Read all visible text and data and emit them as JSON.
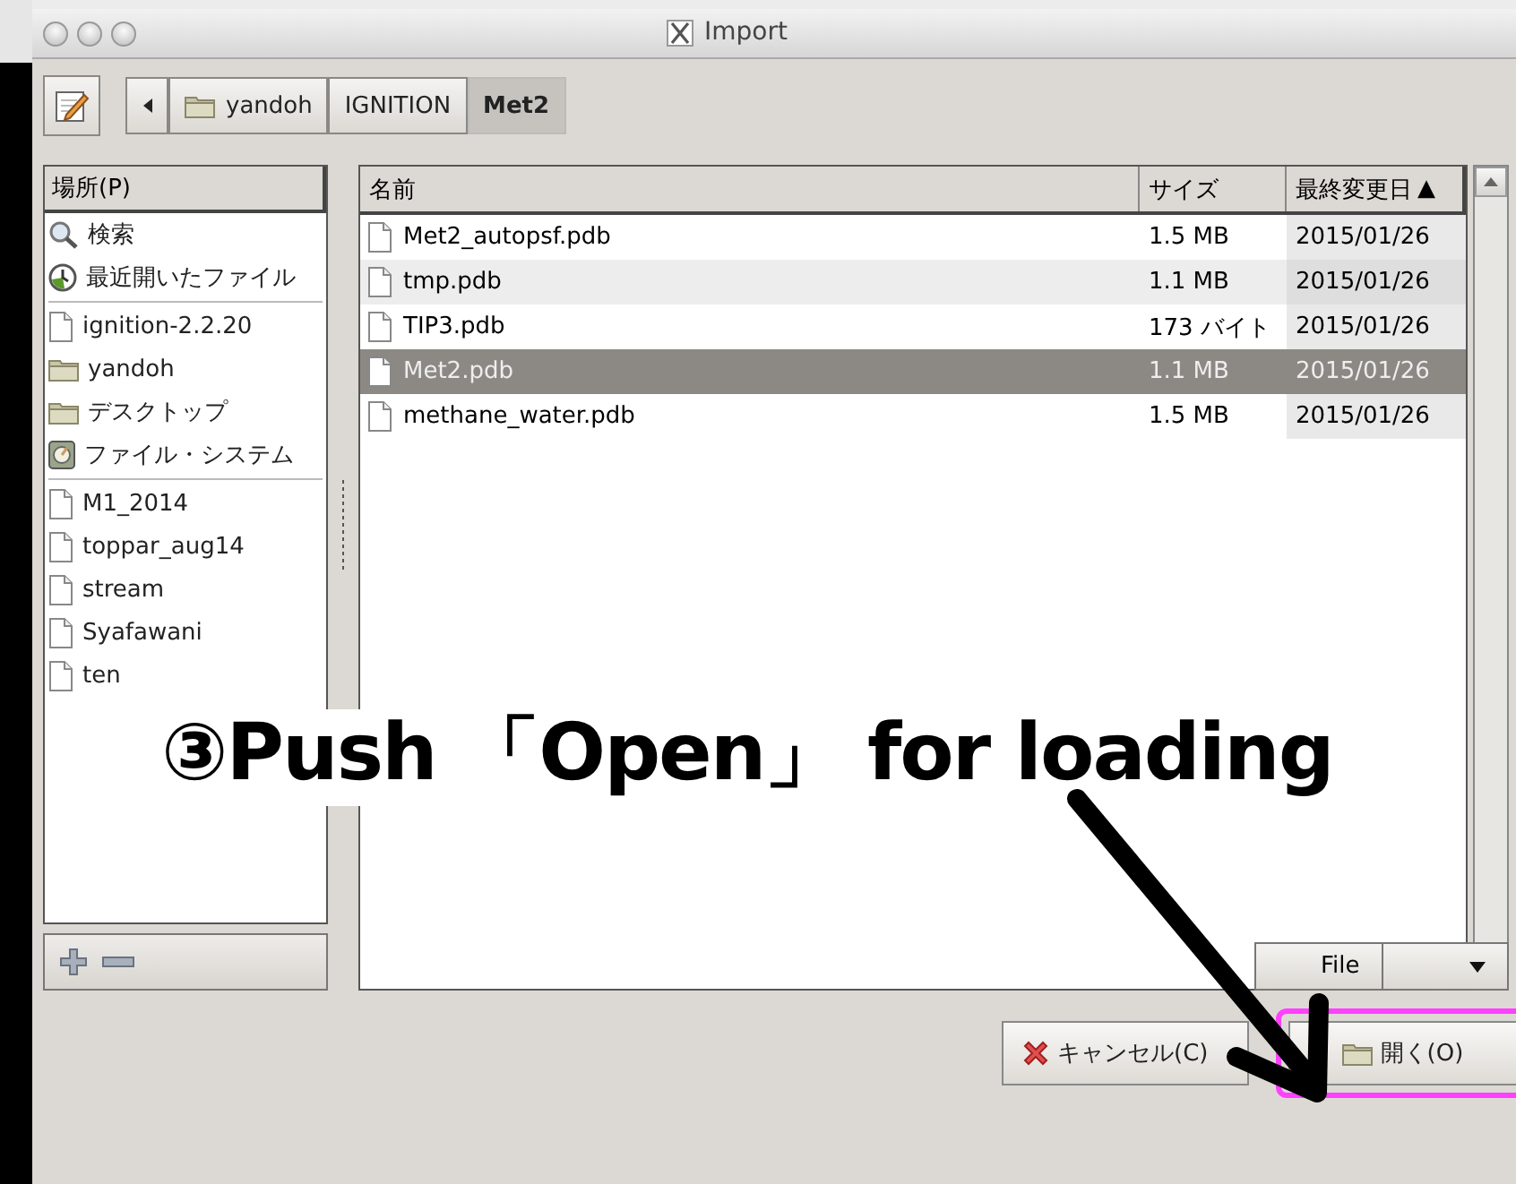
{
  "window": {
    "title": "Import"
  },
  "path_bar": {
    "segments": [
      {
        "label": "yandoh",
        "kind": "folder",
        "selected": false
      },
      {
        "label": "IGNITION",
        "kind": "plain",
        "selected": false
      },
      {
        "label": "Met2",
        "kind": "plain",
        "selected": true
      }
    ]
  },
  "places": {
    "header": "場所(P)",
    "groups": [
      [
        {
          "label": "検索",
          "kind": "search"
        },
        {
          "label": "最近開いたファイル",
          "kind": "recent"
        }
      ],
      [
        {
          "label": "ignition-2.2.20",
          "kind": "file"
        },
        {
          "label": "yandoh",
          "kind": "folder"
        },
        {
          "label": "デスクトップ",
          "kind": "folder"
        },
        {
          "label": "ファイル・システム",
          "kind": "filesystem"
        }
      ],
      [
        {
          "label": "M1_2014",
          "kind": "file"
        },
        {
          "label": "toppar_aug14",
          "kind": "file"
        },
        {
          "label": "stream",
          "kind": "file"
        },
        {
          "label": "Syafawani",
          "kind": "file"
        },
        {
          "label": "ten",
          "kind": "file"
        }
      ]
    ]
  },
  "files": {
    "columns": [
      {
        "label": "名前",
        "sorted": false
      },
      {
        "label": "サイズ",
        "sorted": false
      },
      {
        "label": "最終変更日",
        "sorted": true
      }
    ],
    "sort_indicator": "▲",
    "rows": [
      {
        "name": "Met2_autopsf.pdb",
        "size": "1.5 MB",
        "modified": "2015/01/26",
        "selected": false
      },
      {
        "name": "tmp.pdb",
        "size": "1.1 MB",
        "modified": "2015/01/26",
        "selected": false
      },
      {
        "name": "TIP3.pdb",
        "size": "173 バイト",
        "modified": "2015/01/26",
        "selected": false
      },
      {
        "name": "Met2.pdb",
        "size": "1.1 MB",
        "modified": "2015/01/26",
        "selected": true
      },
      {
        "name": "methane_water.pdb",
        "size": "1.5 MB",
        "modified": "2015/01/26",
        "selected": false
      }
    ]
  },
  "filter": {
    "value": "File"
  },
  "buttons": [
    {
      "label": "キャンセル(C)",
      "kind": "cancel",
      "highlighted": false
    },
    {
      "label": "開く(O)",
      "kind": "open",
      "highlighted": true
    }
  ],
  "annotation": {
    "text": "③Push 「Open」 for loading"
  }
}
